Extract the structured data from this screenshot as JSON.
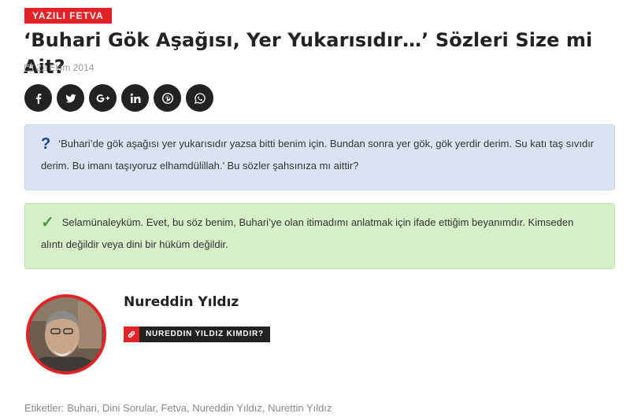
{
  "category": "YAZILI FETVA",
  "title": "‘Buhari Gök Aşağısı, Yer Yukarısıdır…’ Sözleri Size mi Ait?",
  "date": "22 Ekim 2014",
  "share": [
    {
      "icon": "facebook-icon"
    },
    {
      "icon": "twitter-icon"
    },
    {
      "icon": "google-plus-icon"
    },
    {
      "icon": "linkedin-icon"
    },
    {
      "icon": "pinterest-icon"
    },
    {
      "icon": "whatsapp-icon"
    }
  ],
  "question": {
    "mark": "?",
    "text": "‘Buhari’de gök aşağısı yer yukarısıdır yazsa bitti benim için. Bundan sonra yer gök, gök yerdir derim. Su katı taş sıvıdır derim. Bu imanı taşıyoruz elhamdülillah.’ Bu sözler şahsınıza mı aittir?"
  },
  "answer": {
    "mark": "✓",
    "text": "Selamünaleyküm. Evet, bu söz benim, Buhari’ye olan itimadımı anlatmak için ifade ettiğim beyanımdır. Kimseden alıntı değildir veya dini bir hüküm değildir."
  },
  "author": {
    "name": "Nureddin Yıldız",
    "link_label": "NUREDDIN YILDIZ KIMDIR?"
  },
  "tags": {
    "prefix": "Etiketler:",
    "items": [
      "Buhari",
      "Dini Sorular",
      "Fetva",
      "Nureddin Yıldız",
      "Nurettin Yıldız"
    ]
  },
  "colors": {
    "accent": "#e32228",
    "dark": "#222222",
    "question_bg": "#d9e3f2",
    "answer_bg": "#d6efc8"
  }
}
